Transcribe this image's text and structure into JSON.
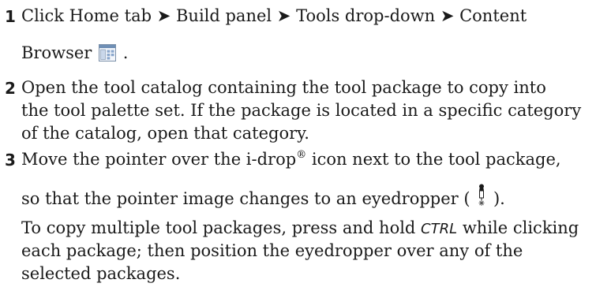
{
  "steps": [
    {
      "num": "1",
      "l1": "Click Home tab ➤ Build panel ➤ Tools drop-down ➤ Content",
      "l2_pre": "Browser",
      "l2_post": "."
    },
    {
      "num": "2",
      "l1": "Open the tool catalog containing the tool package to copy into",
      "l2": "the tool palette set. If the package is located in a specific category",
      "l3": "of the catalog, open that category."
    },
    {
      "num": "3",
      "l1_pre": "Move the pointer over the i-drop",
      "l1_sup": "®",
      "l1_post": " icon next to the tool package,",
      "l2_pre": "so that the pointer image changes to an eyedropper (",
      "l2_post": ").",
      "p_pre": "To copy multiple tool packages, press and hold ",
      "p_key": "CTRL",
      "p_post": " while clicking",
      "p2": "each package; then position the eyedropper over any of the",
      "p3": "selected packages."
    }
  ],
  "icons": {
    "content_browser": "content-browser-icon",
    "eyedropper": "eyedropper-icon"
  }
}
